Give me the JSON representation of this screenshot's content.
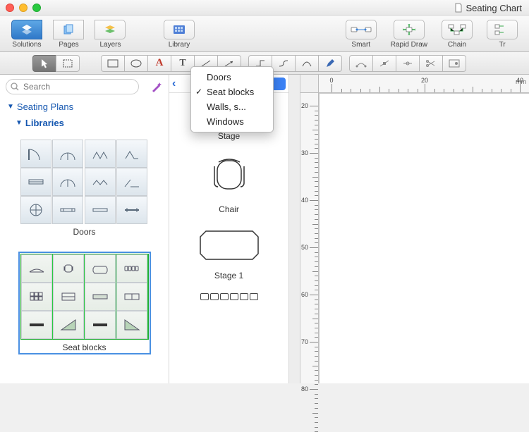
{
  "window": {
    "doc_title": "Seating Chart"
  },
  "toolbar": {
    "solutions": "Solutions",
    "pages": "Pages",
    "layers": "Layers",
    "library": "Library",
    "smart": "Smart",
    "rapid_draw": "Rapid Draw",
    "chain": "Chain",
    "tr": "Tr"
  },
  "search": {
    "placeholder": "Search"
  },
  "sidebar": {
    "heading": "Seating Plans",
    "libraries": "Libraries",
    "lib1_title": "Doors",
    "lib2_title": "Seat blocks"
  },
  "dropdown": {
    "items": [
      "Doors",
      "Seat blocks",
      "Walls, s...",
      "Windows"
    ],
    "checked_index": 1
  },
  "midpanel": {
    "shape1": "Stage",
    "shape2": "Chair",
    "shape3": "Stage 1"
  },
  "ruler": {
    "unit": "mm",
    "h_labels": [
      "0",
      "20",
      "40"
    ],
    "v_labels": [
      "20",
      "30",
      "40",
      "50",
      "60",
      "70",
      "80"
    ]
  }
}
